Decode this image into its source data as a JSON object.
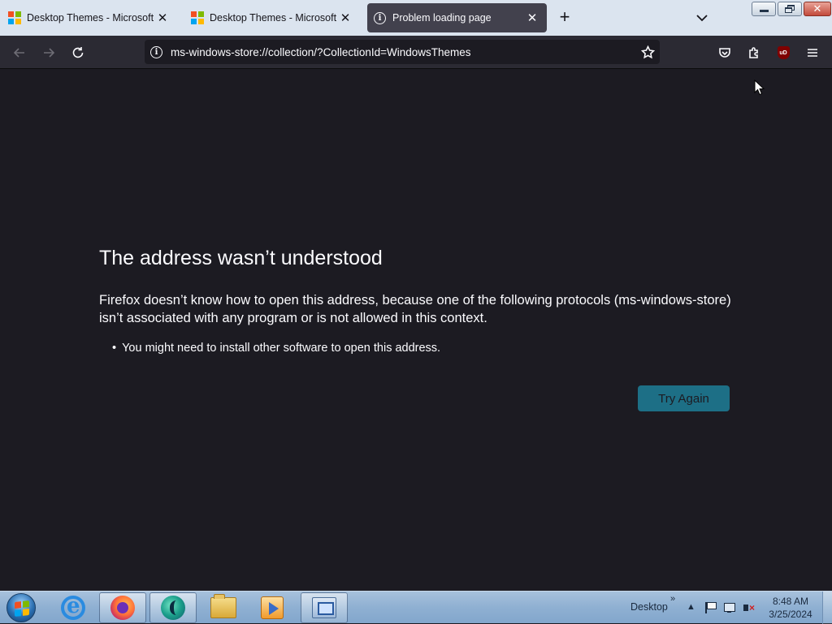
{
  "browser": {
    "tabs": [
      {
        "title": "Desktop Themes - Microsoft Su",
        "active": false,
        "icon": "microsoft-logo-icon"
      },
      {
        "title": "Desktop Themes - Microsoft Su",
        "active": false,
        "icon": "microsoft-logo-icon"
      },
      {
        "title": "Problem loading page",
        "active": true,
        "icon": "info-icon"
      }
    ],
    "new_tab_label": "+",
    "url": "ms-windows-store://collection/?CollectionId=WindowsThemes",
    "ublock_label": "uD"
  },
  "error_page": {
    "title": "The address wasn’t understood",
    "description": "Firefox doesn’t know how to open this address, because one of the following protocols (ms-windows-store) isn’t associated with any program or is not allowed in this context.",
    "bullets": [
      "You might need to install other software to open this address."
    ],
    "try_again_label": "Try Again"
  },
  "taskbar": {
    "pinned": [
      {
        "name": "internet-explorer-icon"
      },
      {
        "name": "firefox-icon"
      },
      {
        "name": "bing-icon"
      },
      {
        "name": "file-explorer-icon"
      },
      {
        "name": "media-player-icon"
      },
      {
        "name": "remote-desktop-icon"
      }
    ],
    "desktop_label": "Desktop",
    "chevron": "»",
    "tray_up": "▲",
    "time": "8:48 AM",
    "date": "3/25/2024"
  },
  "colors": {
    "page_bg": "#1c1b22",
    "toolbar_bg": "#2b2a33",
    "tabstrip_bg": "#dbe4ef",
    "try_again_bg": "#1d6f86"
  }
}
